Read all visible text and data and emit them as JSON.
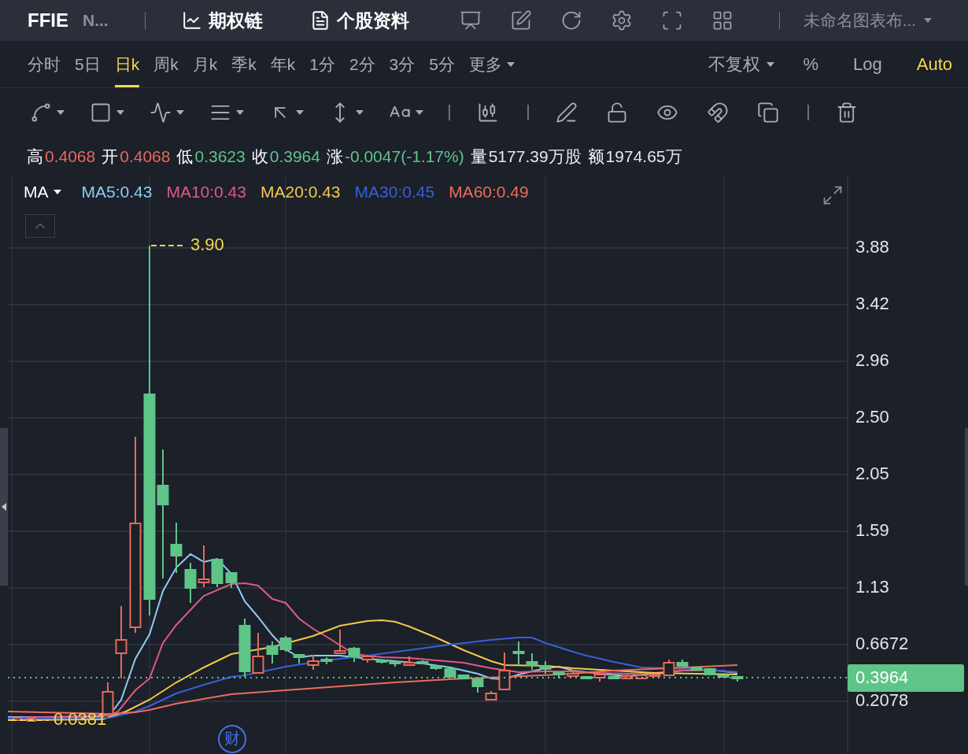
{
  "header": {
    "symbol": "FFIE",
    "name": "N...",
    "links": [
      {
        "kind": "chart",
        "label": "期权链"
      },
      {
        "kind": "doc",
        "label": "个股资料"
      }
    ],
    "tools": [
      {
        "kind": "screen"
      },
      {
        "kind": "edit"
      },
      {
        "kind": "refresh"
      },
      {
        "kind": "settings"
      },
      {
        "kind": "fullscreen"
      },
      {
        "kind": "grid"
      }
    ],
    "layout": "未命名图表布..."
  },
  "periods": [
    {
      "label": "分时",
      "selected": false
    },
    {
      "label": "5日",
      "selected": false
    },
    {
      "label": "日k",
      "selected": true
    },
    {
      "label": "周k",
      "selected": false
    },
    {
      "label": "月k",
      "selected": false
    },
    {
      "label": "季k",
      "selected": false
    },
    {
      "label": "年k",
      "selected": false
    },
    {
      "label": "1分",
      "selected": false
    },
    {
      "label": "2分",
      "selected": false
    },
    {
      "label": "3分",
      "selected": false
    },
    {
      "label": "5分",
      "selected": false
    },
    {
      "label": "更多",
      "selected": false,
      "menu": true
    }
  ],
  "adjust": {
    "label": "不复权"
  },
  "scale_options": [
    {
      "label": "%",
      "selected": false
    },
    {
      "label": "Log",
      "selected": false
    },
    {
      "label": "Auto",
      "selected": true
    }
  ],
  "tool_groups": [
    {
      "tools": [
        {
          "kind": "line",
          "menu": true
        },
        {
          "kind": "rect",
          "menu": true
        },
        {
          "kind": "pattern",
          "menu": true
        },
        {
          "kind": "lines",
          "menu": true
        },
        {
          "kind": "arrow",
          "menu": true
        },
        {
          "kind": "measure",
          "menu": true
        },
        {
          "kind": "text",
          "menu": true
        }
      ]
    },
    {
      "tools": [
        {
          "kind": "candles"
        }
      ]
    },
    {
      "tools": [
        {
          "kind": "pen"
        },
        {
          "kind": "lock"
        },
        {
          "kind": "eye"
        },
        {
          "kind": "magnet"
        },
        {
          "kind": "copy"
        }
      ]
    },
    {
      "tools": [
        {
          "kind": "trash"
        }
      ]
    }
  ],
  "quote": [
    {
      "label": "高",
      "value": "0.4068",
      "color": "#e8685a"
    },
    {
      "label": "开",
      "value": "0.4068",
      "color": "#e8685a"
    },
    {
      "label": "低",
      "value": "0.3623",
      "color": "#5fc487"
    },
    {
      "label": "收",
      "value": "0.3964",
      "color": "#5fc487"
    },
    {
      "label": "涨",
      "value": "-0.0047(-1.17%)",
      "color": "#5fc487"
    },
    {
      "label": "量",
      "value": "5177.39万股",
      "color": "#e6e6e6"
    },
    {
      "label": "额",
      "value": "1974.65万",
      "color": "#e6e6e6"
    }
  ],
  "indicator": {
    "label": "MA",
    "items": [
      {
        "label": "MA5:0.43",
        "color": "#8ecbf3"
      },
      {
        "label": "MA10:0.43",
        "color": "#e05a80"
      },
      {
        "label": "MA20:0.43",
        "color": "#f2c94c"
      },
      {
        "label": "MA30:0.45",
        "color": "#3a5fd9"
      },
      {
        "label": "MA60:0.49",
        "color": "#ec6d5a"
      }
    ]
  },
  "chart": {
    "y_labels": [
      "3.88",
      "3.42",
      "2.96",
      "2.50",
      "2.05",
      "1.59",
      "1.13",
      "0.6672",
      "0.2078"
    ],
    "high_label": "3.90",
    "low_label": "0.0381",
    "last_price": "0.3964",
    "event_marker": "财"
  }
}
